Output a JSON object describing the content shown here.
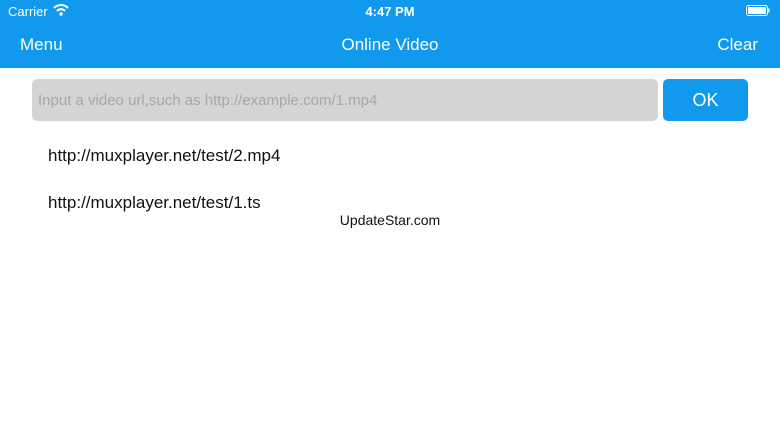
{
  "status_bar": {
    "carrier": "Carrier",
    "time": "4:47 PM",
    "icons": [
      "wifi-icon",
      "battery-icon"
    ]
  },
  "nav": {
    "left_label": "Menu",
    "title": "Online Video",
    "right_label": "Clear"
  },
  "url_input": {
    "value": "",
    "placeholder": "Input a video url,such as http://example.com/1.mp4"
  },
  "ok_button": {
    "label": "OK"
  },
  "history": [
    {
      "url": "http://muxplayer.net/test/2.mp4"
    },
    {
      "url": "http://muxplayer.net/test/1.ts"
    }
  ],
  "watermark": "UpdateStar.com",
  "colors": {
    "accent": "#1199ee",
    "input_background": "#d4d4d4"
  }
}
